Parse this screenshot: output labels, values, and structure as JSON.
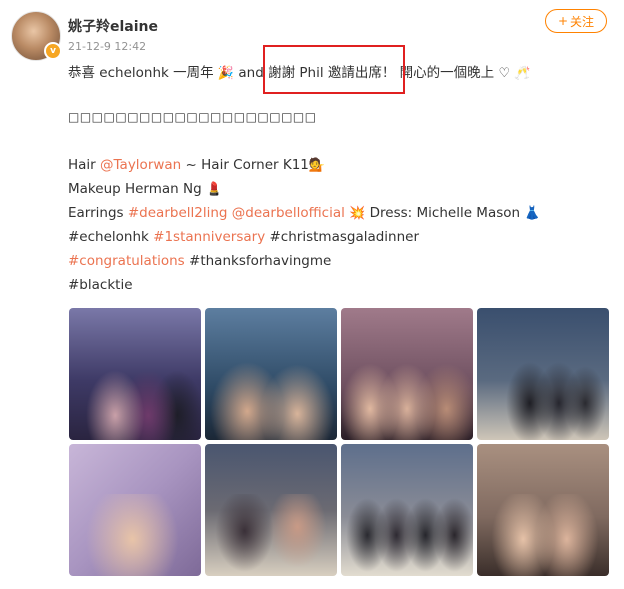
{
  "post": {
    "username": "姚子羚elaine",
    "timestamp": "21-12-9 12:42",
    "follow_label": "关注",
    "follow_plus": "+",
    "line1": {
      "pre": "恭喜 echelonhk 一周年 ",
      "mid": " and ",
      "thanks": "謝謝 Phil 邀請出席！",
      "post": " 開心的一個晚上 "
    },
    "placeholder_line": "□□□□□□□□□□□□□□□□□□□□□",
    "credits": {
      "hair_label": "Hair ",
      "hair_tag": "@Taylorwan",
      "hair_rest": " ~ Hair Corner K11",
      "makeup": "Makeup Herman Ng ",
      "earrings_label": "Earrings ",
      "earrings_tag1": "#dearbell2ling",
      "earrings_tag2": "@dearbellofficial",
      "dress": " Dress: Michelle Mason "
    },
    "hashtags": {
      "h1": "#echelonhk ",
      "h2": "#1stanniversary",
      "h3": " #christmasgaladinner",
      "h4": "#congratulations",
      "h5": " #thanksforhavingme",
      "h6": "#blacktie"
    },
    "emojis": {
      "party": "🎉",
      "heart": "♡",
      "cheers": "🥂",
      "woman": "💁",
      "lipstick": "💄",
      "sparkle": "💥",
      "dress": "👗"
    },
    "photos": [
      {
        "alt": "photo-1"
      },
      {
        "alt": "photo-2"
      },
      {
        "alt": "photo-3"
      },
      {
        "alt": "photo-4"
      },
      {
        "alt": "photo-5"
      },
      {
        "alt": "photo-6"
      },
      {
        "alt": "photo-7"
      },
      {
        "alt": "photo-8"
      }
    ],
    "colors": {
      "accent": "#ff8200",
      "link": "#eb7350",
      "highlight": "#e02020"
    }
  }
}
